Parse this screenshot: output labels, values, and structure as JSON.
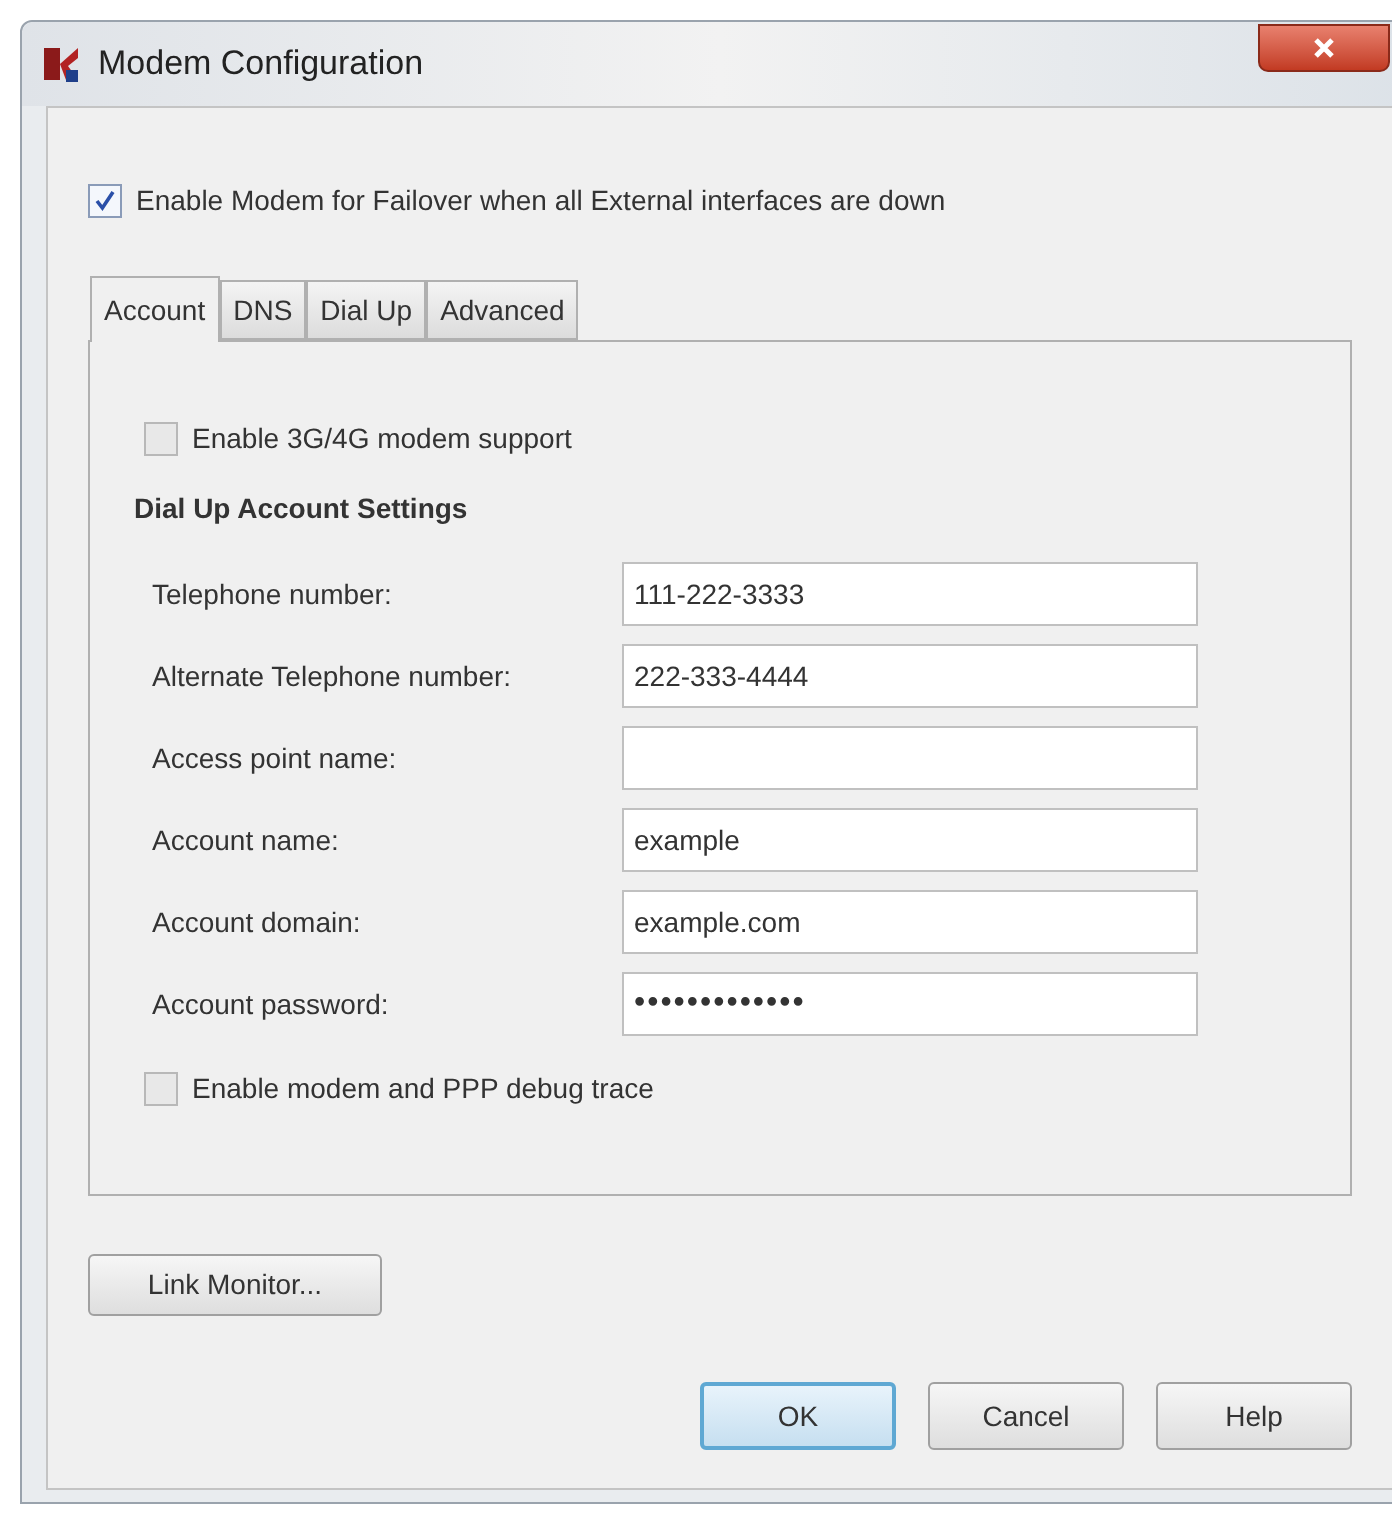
{
  "window": {
    "title": "Modem Configuration"
  },
  "failover_checkbox": {
    "label": "Enable Modem for Failover when all External interfaces are down",
    "checked": true
  },
  "tabs": [
    {
      "label": "Account",
      "selected": true
    },
    {
      "label": "DNS",
      "selected": false
    },
    {
      "label": "Dial Up",
      "selected": false
    },
    {
      "label": "Advanced",
      "selected": false
    }
  ],
  "modem_support_checkbox": {
    "label": "Enable 3G/4G modem support",
    "checked": false
  },
  "section_heading": "Dial Up Account Settings",
  "fields": [
    {
      "label": "Telephone number:",
      "value": "111-222-3333",
      "kind": "text"
    },
    {
      "label": "Alternate Telephone number:",
      "value": "222-333-4444",
      "kind": "text"
    },
    {
      "label": "Access point name:",
      "kind": "text"
    },
    {
      "label": "Account name:",
      "value": "example",
      "kind": "text"
    },
    {
      "label": "Account domain:",
      "value": "example.com",
      "kind": "text"
    },
    {
      "label": "Account password:",
      "value": "•••••••••••••",
      "kind": "password"
    }
  ],
  "debug_checkbox": {
    "label": "Enable modem and PPP debug trace",
    "checked": false
  },
  "link_monitor_button": "Link Monitor...",
  "buttons": [
    {
      "label": "OK",
      "default": true
    },
    {
      "label": "Cancel",
      "default": false
    },
    {
      "label": "Help",
      "default": false
    }
  ]
}
